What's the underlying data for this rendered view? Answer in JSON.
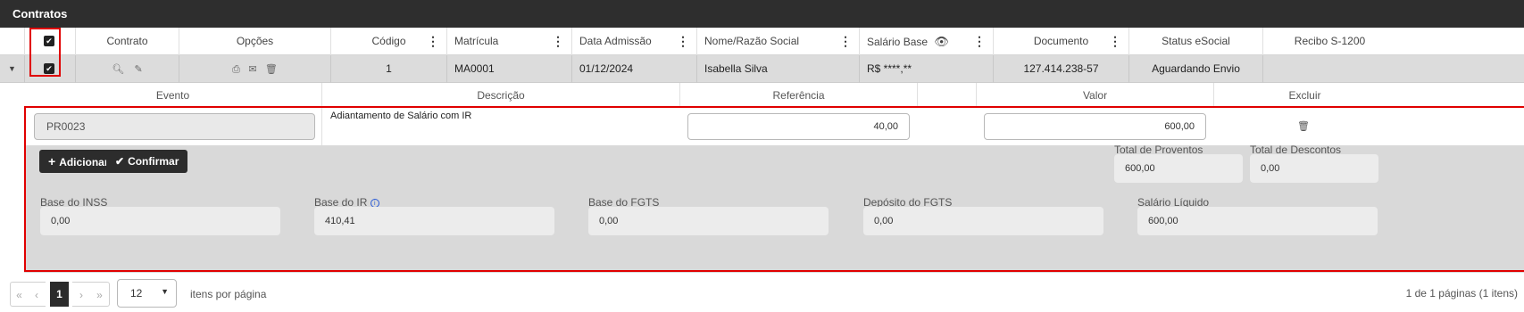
{
  "panel_title": "Contratos",
  "columns": {
    "contrato": "Contrato",
    "opcoes": "Opções",
    "codigo": "Código",
    "matricula": "Matrícula",
    "data_admissao": "Data Admissão",
    "nome": "Nome/Razão Social",
    "salario_base": "Salário Base",
    "documento": "Documento",
    "status_esocial": "Status eSocial",
    "recibo": "Recibo S-1200"
  },
  "row": {
    "codigo": "1",
    "matricula": "MA0001",
    "data_admissao": "01/12/2024",
    "nome": "Isabella Silva",
    "salario_base": "R$ ****,**",
    "documento": "127.414.238-57",
    "status_esocial": "Aguardando Envio",
    "recibo": ""
  },
  "detail_columns": {
    "evento": "Evento",
    "descricao": "Descrição",
    "referencia": "Referência",
    "valor": "Valor",
    "excluir": "Excluir"
  },
  "detail_row": {
    "evento": "PR0023",
    "descricao": "Adiantamento de Salário com IR",
    "referencia": "40,00",
    "valor": "600,00"
  },
  "actions": {
    "adicionar": "Adicionar",
    "confirmar": "Confirmar"
  },
  "totals": {
    "proventos_label": "Total de Proventos",
    "proventos_value": "600,00",
    "descontos_label": "Total de Descontos",
    "descontos_value": "0,00"
  },
  "bases": {
    "inss_label": "Base do INSS",
    "inss_value": "0,00",
    "ir_label": "Base do IR",
    "ir_value": "410,41",
    "fgts_label": "Base do FGTS",
    "fgts_value": "0,00",
    "deposito_label": "Depósito do FGTS",
    "deposito_value": "0,00",
    "liquido_label": "Salário Líquido",
    "liquido_value": "600,00"
  },
  "pagination": {
    "current_page": "1",
    "page_size": "12",
    "per_page_label": "itens por página",
    "summary": "1 de 1 páginas (1 itens)"
  },
  "colors": {
    "titlebar": "#2e2e2e",
    "row_selected": "#dcdcdc",
    "panel": "#d9d9d9",
    "highlight": "#e00000"
  }
}
